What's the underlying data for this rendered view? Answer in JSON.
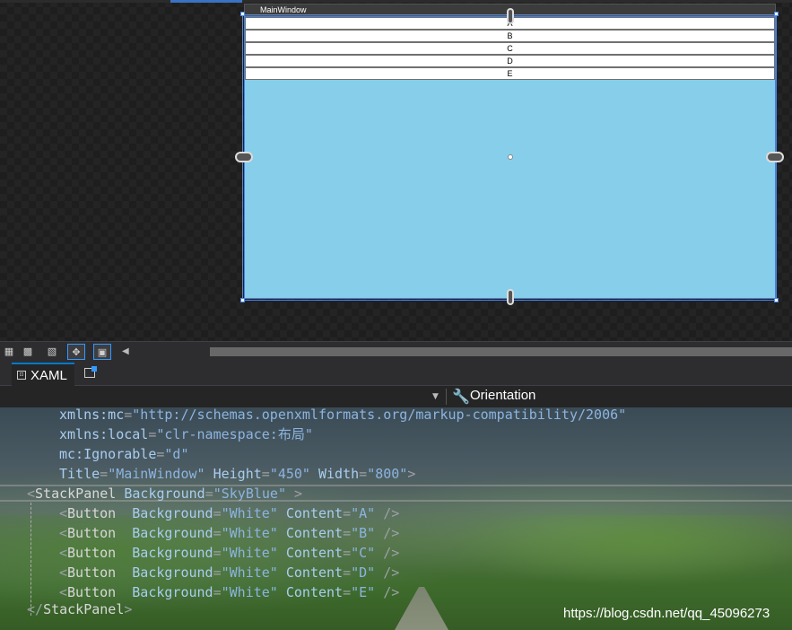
{
  "designer": {
    "window_title": "MainWindow",
    "buttons": [
      "A",
      "B",
      "C",
      "D",
      "E"
    ],
    "panel_background": "#87CEEB"
  },
  "toolbar": {
    "icons": [
      "grid-icon",
      "snap-grid-icon",
      "checker-icon",
      "artboard-icon",
      "code-view-icon"
    ]
  },
  "tabs": {
    "xaml_label": "XAML"
  },
  "navbar": {
    "property_label": "Orientation"
  },
  "code": {
    "line1_attr": "xmlns:mc",
    "line1_val": "\"http://schemas.openxmlformats.org/markup-compatibility/2006\"",
    "line2_attr": "xmlns:local",
    "line2_val": "\"clr-namespace:布局\"",
    "line3_attr": "mc:Ignorable",
    "line3_val": "\"d\"",
    "line4_attr1": "Title",
    "line4_val1": "\"MainWindow\"",
    "line4_attr2": "Height",
    "line4_val2": "\"450\"",
    "line4_attr3": "Width",
    "line4_val3": "\"800\"",
    "stackpanel_tag": "StackPanel",
    "stackpanel_attr": "Background",
    "stackpanel_val": "\"SkyBlue\"",
    "button_tag": "Button",
    "button_attr1": "Background",
    "button_val1": "\"White\"",
    "button_attr2": "Content",
    "button_contents": [
      "\"A\"",
      "\"B\"",
      "\"C\"",
      "\"D\"",
      "\"E\""
    ],
    "close_tag": "StackPanel"
  },
  "watermark": "https://blog.csdn.net/qq_45096273"
}
